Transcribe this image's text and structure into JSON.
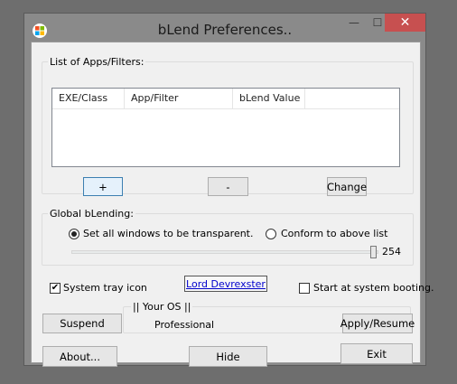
{
  "window": {
    "title": "bLend Preferences..",
    "minimize_glyph": "—",
    "maximize_glyph": "☐",
    "close_glyph": "✕"
  },
  "apps_group": {
    "label": "List of Apps/Filters:",
    "columns": [
      "EXE/Class",
      "App/Filter",
      "bLend Value"
    ],
    "rows": []
  },
  "buttons": {
    "add": "+",
    "remove": "-",
    "change": "Change",
    "suspend": "Suspend",
    "apply": "Apply/Resume",
    "about": "About...",
    "hide": "Hide",
    "exit": "Exit"
  },
  "global_group": {
    "label": "Global bLending:",
    "radio_all": "Set all windows to be transparent.",
    "radio_list": "Conform to above list",
    "selected": "all",
    "slider_value": "254",
    "slider_max": 255
  },
  "options": {
    "tray_icon_label": "System tray icon",
    "tray_icon_checked": true,
    "startup_label": "Start at system booting.",
    "startup_checked": false,
    "author_link": "Lord Devrexster"
  },
  "os_group": {
    "label": "|| Your OS ||",
    "value": "Professional"
  },
  "icons": {
    "app": "windows-logo",
    "check": "✔"
  }
}
